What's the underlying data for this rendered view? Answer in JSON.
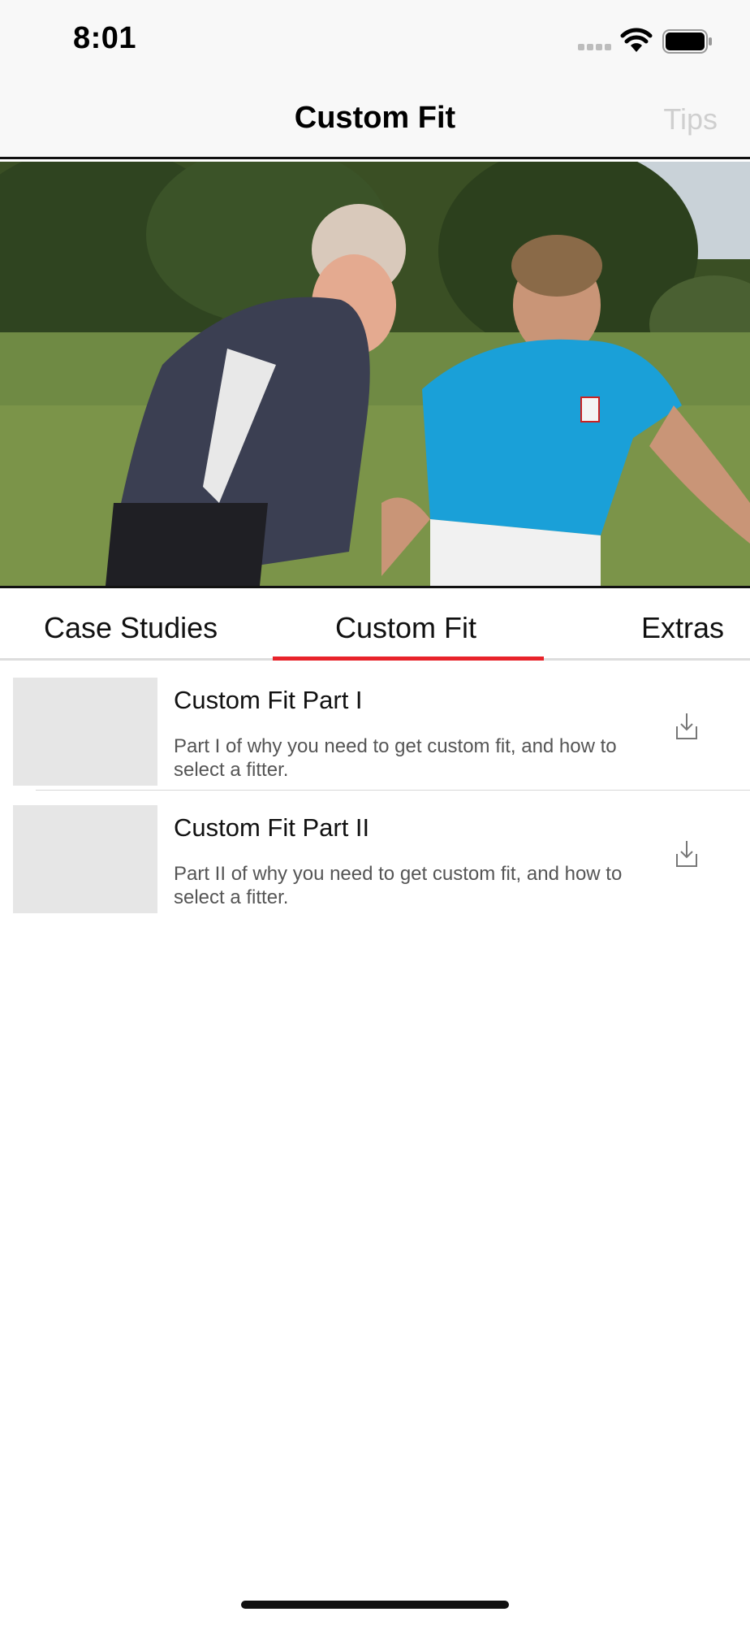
{
  "status_bar": {
    "time": "8:01"
  },
  "nav": {
    "title": "Custom Fit",
    "right_button": "Tips"
  },
  "video": {
    "image": "video-thumbnail-golfers"
  },
  "tabs": [
    {
      "label": "Case Studies",
      "selected": false
    },
    {
      "label": "Custom Fit",
      "selected": true
    },
    {
      "label": "Extras",
      "selected": false
    }
  ],
  "items": [
    {
      "title": "Custom Fit Part I",
      "description": "Part I of why you need to get custom fit, and how to select a fitter.",
      "icon": "download-icon"
    },
    {
      "title": "Custom Fit Part II",
      "description": "Part II of why you need to get custom fit, and how to select a fitter.",
      "icon": "download-icon"
    }
  ],
  "colors": {
    "accent": "#e8232a",
    "nav_background": "#f8f8f8",
    "disabled_text": "#cfcfcf",
    "thumbnail_placeholder": "#e6e6e6"
  }
}
